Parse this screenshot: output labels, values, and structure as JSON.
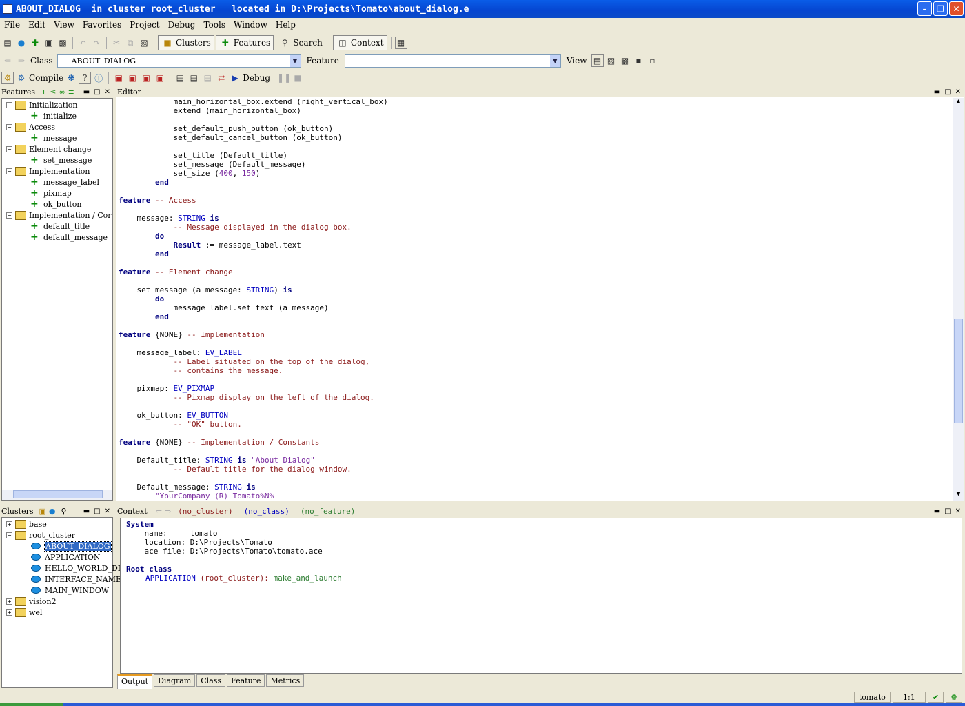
{
  "window": {
    "title": "ABOUT_DIALOG  in cluster root_cluster   located in D:\\Projects\\Tomato\\about_dialog.e"
  },
  "menu": [
    "File",
    "Edit",
    "View",
    "Favorites",
    "Project",
    "Debug",
    "Tools",
    "Window",
    "Help"
  ],
  "toolbar": {
    "clusters": "Clusters",
    "features": "Features",
    "search": "Search",
    "context": "Context"
  },
  "addressbar": {
    "class_label": "Class",
    "class_value": "ABOUT_DIALOG",
    "feature_label": "Feature",
    "feature_value": "",
    "view_label": "View"
  },
  "projectbar": {
    "compile": "Compile",
    "debug": "Debug"
  },
  "features_panel": {
    "title": "Features",
    "items": [
      {
        "label": "Initialization",
        "kind": "category"
      },
      {
        "label": "initialize",
        "kind": "feature"
      },
      {
        "label": "Access",
        "kind": "category"
      },
      {
        "label": "message",
        "kind": "feature"
      },
      {
        "label": "Element change",
        "kind": "category"
      },
      {
        "label": "set_message",
        "kind": "feature"
      },
      {
        "label": "Implementation",
        "kind": "category"
      },
      {
        "label": "message_label",
        "kind": "feature"
      },
      {
        "label": "pixmap",
        "kind": "feature"
      },
      {
        "label": "ok_button",
        "kind": "feature"
      },
      {
        "label": "Implementation / Cor",
        "kind": "category"
      },
      {
        "label": "default_title",
        "kind": "feature"
      },
      {
        "label": "default_message",
        "kind": "feature"
      }
    ]
  },
  "clusters_panel": {
    "title": "Clusters",
    "items": [
      {
        "label": "base",
        "kind": "cluster"
      },
      {
        "label": "root_cluster",
        "kind": "cluster"
      },
      {
        "label": "ABOUT_DIALOG",
        "kind": "class",
        "selected": true
      },
      {
        "label": "APPLICATION",
        "kind": "class"
      },
      {
        "label": "HELLO_WORLD_DLG",
        "kind": "class"
      },
      {
        "label": "INTERFACE_NAMES",
        "kind": "class"
      },
      {
        "label": "MAIN_WINDOW",
        "kind": "class"
      },
      {
        "label": "vision2",
        "kind": "cluster"
      },
      {
        "label": "wel",
        "kind": "cluster"
      }
    ]
  },
  "editor": {
    "title": "Editor",
    "lines": [
      [
        [
          "            main_horizontal_box.extend (right_vertical_box)",
          ""
        ]
      ],
      [
        [
          "            extend (main_horizontal_box)",
          ""
        ]
      ],
      [],
      [
        [
          "            set_default_push_button (ok_button)",
          ""
        ]
      ],
      [
        [
          "            set_default_cancel_button (ok_button)",
          ""
        ]
      ],
      [],
      [
        [
          "            set_title (Default_title)",
          ""
        ]
      ],
      [
        [
          "            set_message (Default_message)",
          ""
        ]
      ],
      [
        [
          "            set_size (",
          ""
        ],
        [
          "400",
          "nm"
        ],
        [
          ", ",
          ""
        ],
        [
          "150",
          "nm"
        ],
        [
          ")",
          ""
        ]
      ],
      [
        [
          "        ",
          ""
        ],
        [
          "end",
          "kw"
        ]
      ],
      [],
      [
        [
          "feature",
          "kw"
        ],
        [
          " ",
          ""
        ],
        [
          "-- Access",
          "cm"
        ]
      ],
      [],
      [
        [
          "    message: ",
          ""
        ],
        [
          "STRING",
          "ty"
        ],
        [
          " ",
          ""
        ],
        [
          "is",
          "kw"
        ]
      ],
      [
        [
          "            ",
          ""
        ],
        [
          "-- Message displayed in the dialog box.",
          "cm"
        ]
      ],
      [
        [
          "        ",
          ""
        ],
        [
          "do",
          "kw"
        ]
      ],
      [
        [
          "            ",
          ""
        ],
        [
          "Result",
          "kw"
        ],
        [
          " := message_label.text",
          ""
        ]
      ],
      [
        [
          "        ",
          ""
        ],
        [
          "end",
          "kw"
        ]
      ],
      [],
      [
        [
          "feature",
          "kw"
        ],
        [
          " ",
          ""
        ],
        [
          "-- Element change",
          "cm"
        ]
      ],
      [],
      [
        [
          "    set_message (a_message: ",
          ""
        ],
        [
          "STRING",
          "ty"
        ],
        [
          ") ",
          ""
        ],
        [
          "is",
          "kw"
        ]
      ],
      [
        [
          "        ",
          ""
        ],
        [
          "do",
          "kw"
        ]
      ],
      [
        [
          "            message_label.set_text (a_message)",
          ""
        ]
      ],
      [
        [
          "        ",
          ""
        ],
        [
          "end",
          "kw"
        ]
      ],
      [],
      [
        [
          "feature",
          "kw"
        ],
        [
          " {NONE} ",
          ""
        ],
        [
          "-- Implementation",
          "cm"
        ]
      ],
      [],
      [
        [
          "    message_label: ",
          ""
        ],
        [
          "EV_LABEL",
          "ty"
        ]
      ],
      [
        [
          "            ",
          ""
        ],
        [
          "-- Label situated on the top of the dialog,",
          "cm"
        ]
      ],
      [
        [
          "            ",
          ""
        ],
        [
          "-- contains the message.",
          "cm"
        ]
      ],
      [],
      [
        [
          "    pixmap: ",
          ""
        ],
        [
          "EV_PIXMAP",
          "ty"
        ]
      ],
      [
        [
          "            ",
          ""
        ],
        [
          "-- Pixmap display on the left of the dialog.",
          "cm"
        ]
      ],
      [],
      [
        [
          "    ok_button: ",
          ""
        ],
        [
          "EV_BUTTON",
          "ty"
        ]
      ],
      [
        [
          "            ",
          ""
        ],
        [
          "-- \"OK\" button.",
          "cm"
        ]
      ],
      [],
      [
        [
          "feature",
          "kw"
        ],
        [
          " {NONE} ",
          ""
        ],
        [
          "-- Implementation / Constants",
          "cm"
        ]
      ],
      [],
      [
        [
          "    Default_title: ",
          ""
        ],
        [
          "STRING",
          "ty"
        ],
        [
          " ",
          ""
        ],
        [
          "is",
          "kw"
        ],
        [
          " ",
          ""
        ],
        [
          "\"About Dialog\"",
          "st"
        ]
      ],
      [
        [
          "            ",
          ""
        ],
        [
          "-- Default title for the dialog window.",
          "cm"
        ]
      ],
      [],
      [
        [
          "    Default_message: ",
          ""
        ],
        [
          "STRING",
          "ty"
        ],
        [
          " ",
          ""
        ],
        [
          "is",
          "kw"
        ]
      ],
      [
        [
          "        ",
          ""
        ],
        [
          "\"YourCompany (R) Tomato%N%",
          "st"
        ]
      ]
    ]
  },
  "context_panel": {
    "title": "Context",
    "no_cluster": "(no_cluster)",
    "no_class": "(no_class)",
    "no_feature": "(no_feature)",
    "system_heading": "System",
    "name_line": "    name:     tomato",
    "location_line": "    location: D:\\Projects\\Tomato",
    "ace_line": "    ace file: D:\\Projects\\Tomato\\tomato.ace",
    "root_heading": "Root class",
    "root_class": "APPLICATION",
    "root_cluster": " (root_cluster): ",
    "root_feature": "make_and_launch"
  },
  "bottom_tabs": [
    "Output",
    "Diagram",
    "Class",
    "Feature",
    "Metrics"
  ],
  "status": {
    "project": "tomato",
    "position": "1:1"
  }
}
